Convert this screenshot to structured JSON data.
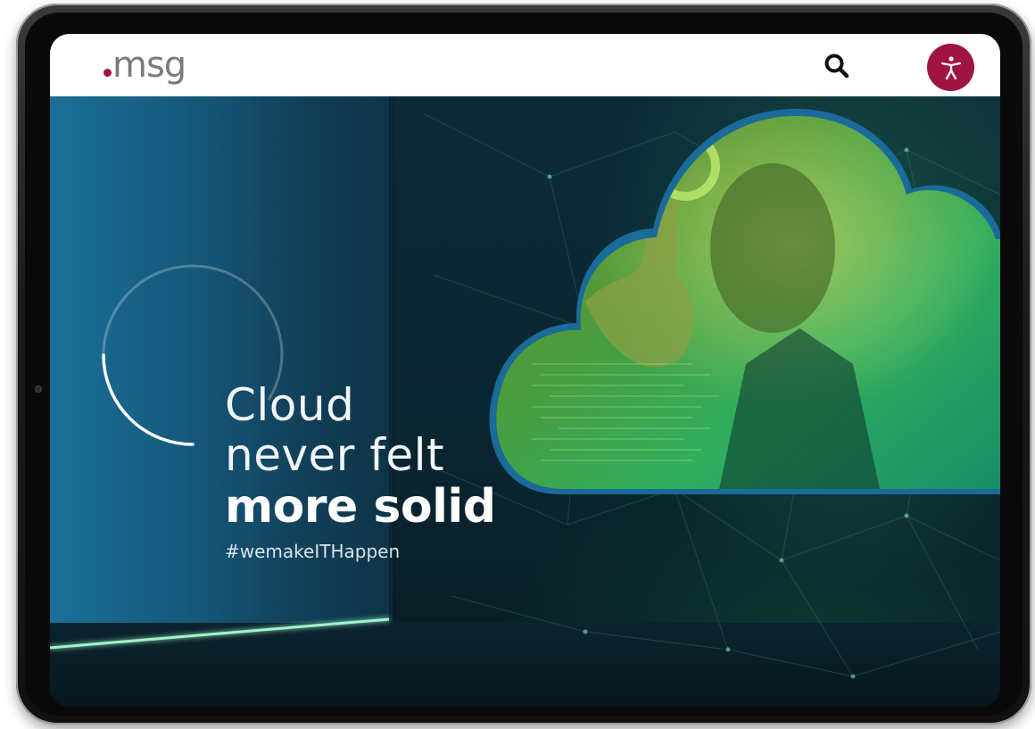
{
  "header": {
    "logo_text": "msg",
    "search_icon": "search-icon",
    "accessibility_icon": "accessibility-icon"
  },
  "hero": {
    "headline_line1": "Cloud",
    "headline_line2": "never felt",
    "headline_line3": "more solid",
    "hashtag": "#wemakeITHappen"
  },
  "colors": {
    "brand_accent": "#a01441",
    "logo_grey": "#7a7a7e",
    "hero_blue": "#16597c",
    "glow_green": "#3ddc84"
  }
}
